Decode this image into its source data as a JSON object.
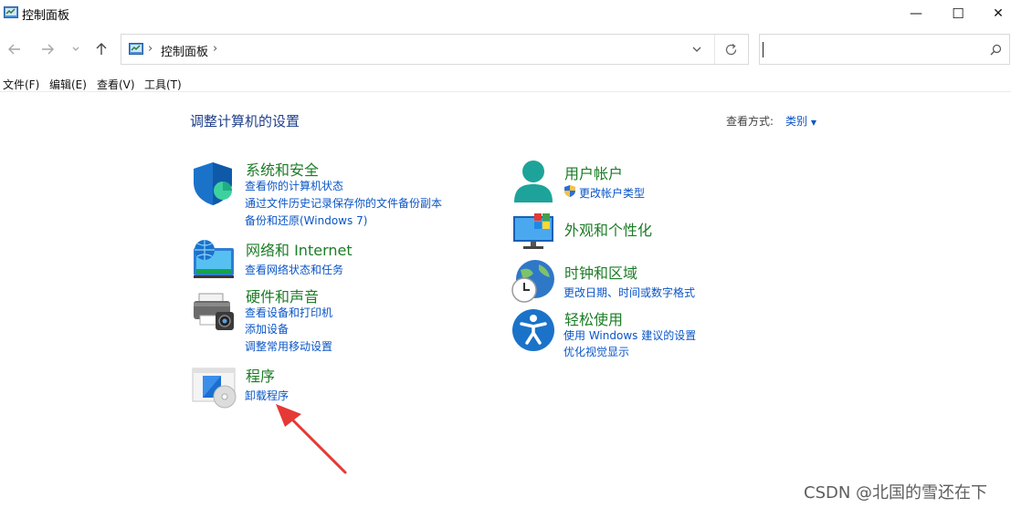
{
  "window": {
    "title": "控制面板",
    "minimize_glyph": "—",
    "maximize_glyph": "☐",
    "close_glyph": "✕"
  },
  "nav": {
    "back_icon": "arrow-left-icon",
    "forward_icon": "arrow-right-icon",
    "recent_icon": "chevron-down-icon",
    "up_icon": "arrow-up-icon"
  },
  "address": {
    "separator": "›",
    "crumb": "控制面板",
    "trailing_separator": "›"
  },
  "search": {
    "placeholder": ""
  },
  "menu": [
    "文件(F)",
    "编辑(E)",
    "查看(V)",
    "工具(T)"
  ],
  "main": {
    "heading": "调整计算机的设置",
    "view_by_label": "查看方式:",
    "view_by_value": "类别"
  },
  "categories": {
    "security": {
      "title": "系统和安全",
      "links": [
        "查看你的计算机状态",
        "通过文件历史记录保存你的文件备份副本",
        "备份和还原(Windows 7)"
      ]
    },
    "network": {
      "title": "网络和 Internet",
      "links": [
        "查看网络状态和任务"
      ]
    },
    "hardware": {
      "title": "硬件和声音",
      "links": [
        "查看设备和打印机",
        "添加设备",
        "调整常用移动设置"
      ]
    },
    "programs": {
      "title": "程序",
      "links": [
        "卸载程序"
      ]
    },
    "accounts": {
      "title": "用户帐户",
      "links": [
        "更改帐户类型"
      ]
    },
    "appearance": {
      "title": "外观和个性化",
      "links": []
    },
    "clock": {
      "title": "时钟和区域",
      "links": [
        "更改日期、时间或数字格式"
      ]
    },
    "ease": {
      "title": "轻松使用",
      "links": [
        "使用 Windows 建议的设置",
        "优化视觉显示"
      ]
    }
  },
  "annotation": {
    "color": "#e53935"
  },
  "watermark": "CSDN @北国的雪还在下",
  "colors": {
    "category_green": "#1c7c26",
    "link_blue": "#0a55c7",
    "heading_blue": "#1e3f8a"
  }
}
